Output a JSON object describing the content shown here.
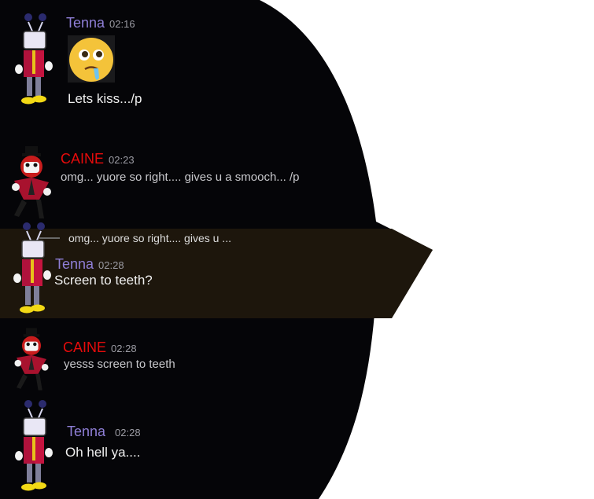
{
  "colors": {
    "background": "#050508",
    "highlight_row": "#1d160c",
    "tenna_name": "#8f7fd7",
    "caine_name": "#e60b0b",
    "timestamp": "#9c9ca4"
  },
  "messages": [
    {
      "author": "Tenna",
      "time": "02:16",
      "emoji": "drooling-face-emoji",
      "text": "Lets kiss.../p"
    },
    {
      "author": "CAINE",
      "time": "02:23",
      "text": "omg... yuore so right.... gives u a smooch... /p"
    },
    {
      "author": "Tenna",
      "time": "02:28",
      "reply_preview": "omg... yuore so right.... gives u ...",
      "text": "Screen to teeth?"
    },
    {
      "author": "CAINE",
      "time": "02:28",
      "text": "yesss screen to teeth"
    },
    {
      "author": "Tenna",
      "time": "02:28",
      "text": "Oh hell ya...."
    }
  ]
}
